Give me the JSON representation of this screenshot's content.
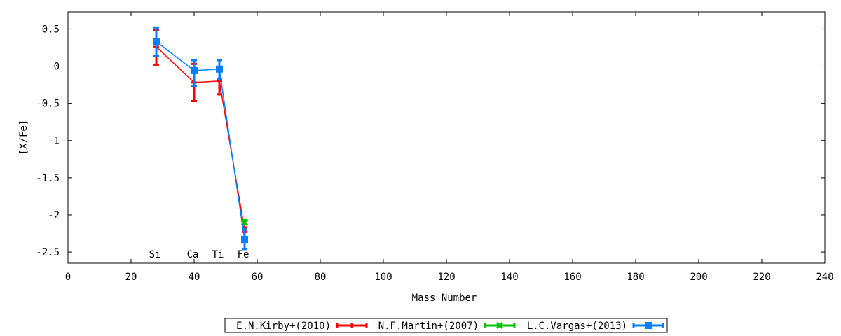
{
  "chart_data": {
    "type": "line",
    "title": "",
    "xlabel": "Mass Number",
    "ylabel": "[X/Fe]",
    "xlim": [
      0,
      240
    ],
    "ylim": [
      -2.65,
      0.73
    ],
    "xticks": [
      0,
      20,
      40,
      60,
      80,
      100,
      120,
      140,
      160,
      180,
      200,
      220,
      240
    ],
    "yticks": [
      0.5,
      0,
      -0.5,
      -1,
      -1.5,
      -2,
      -2.5
    ],
    "ytick_labels": [
      "0.5",
      "0",
      "-0.5",
      "-1",
      "-1.5",
      "-2",
      "-2.5"
    ],
    "grid": false,
    "legend_position": "bottom-center",
    "element_labels": [
      {
        "text": "Si",
        "x": 28
      },
      {
        "text": "Ca",
        "x": 40
      },
      {
        "text": "Ti",
        "x": 48
      },
      {
        "text": "Fe",
        "x": 56
      }
    ],
    "series": [
      {
        "name": "E.N.Kirby+(2010)",
        "color": "#ff0000",
        "marker": "plus",
        "points": [
          {
            "x": 28,
            "y": 0.26,
            "err_low": 0.02,
            "err_high": 0.49
          },
          {
            "x": 40,
            "y": -0.22,
            "err_low": -0.47,
            "err_high": 0.03
          },
          {
            "x": 48,
            "y": -0.2,
            "err_low": -0.38,
            "err_high": -0.02
          },
          {
            "x": 56,
            "y": -2.2,
            "err_low": -2.23,
            "err_high": -2.17
          }
        ]
      },
      {
        "name": "N.F.Martin+(2007)",
        "color": "#00c000",
        "marker": "cross",
        "points": [
          {
            "x": 56,
            "y": -2.1,
            "err_low": -2.13,
            "err_high": -2.07
          }
        ]
      },
      {
        "name": "L.C.Vargas+(2013)",
        "color": "#0080ff",
        "marker": "square",
        "points": [
          {
            "x": 28,
            "y": 0.33,
            "err_low": 0.14,
            "err_high": 0.52
          },
          {
            "x": 40,
            "y": -0.06,
            "err_low": -0.27,
            "err_high": 0.08
          },
          {
            "x": 48,
            "y": -0.04,
            "err_low": -0.17,
            "err_high": 0.08
          },
          {
            "x": 56,
            "y": -2.33,
            "err_low": -2.46,
            "err_high": -2.19
          }
        ]
      }
    ]
  }
}
